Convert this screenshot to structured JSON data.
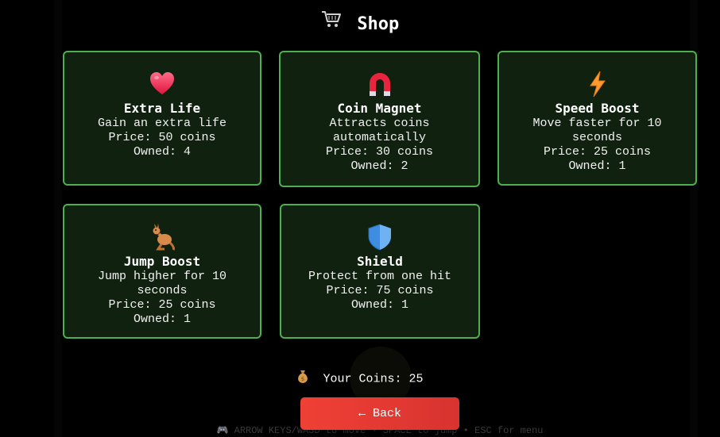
{
  "header": {
    "icon": "shopping-cart-icon",
    "title": "Shop"
  },
  "items": [
    {
      "icon": "heart-icon",
      "name": "Extra Life",
      "description": "Gain an extra life",
      "price": "Price: 50 coins",
      "owned": "Owned: 4"
    },
    {
      "icon": "magnet-icon",
      "name": "Coin Magnet",
      "description": "Attracts coins automatically",
      "price": "Price: 30 coins",
      "owned": "Owned: 2"
    },
    {
      "icon": "lightning-icon",
      "name": "Speed Boost",
      "description": "Move faster for 10 seconds",
      "price": "Price: 25 coins",
      "owned": "Owned: 1"
    },
    {
      "icon": "kangaroo-icon",
      "name": "Jump Boost",
      "description": "Jump higher for 10 seconds",
      "price": "Price: 25 coins",
      "owned": "Owned: 1"
    },
    {
      "icon": "shield-icon",
      "name": "Shield",
      "description": "Protect from one hit",
      "price": "Price: 75 coins",
      "owned": "Owned: 1"
    }
  ],
  "wallet": {
    "icon": "money-bag-icon",
    "label": "Your Coins:",
    "value": "25"
  },
  "back_button": {
    "label": "← Back"
  },
  "hint": {
    "text": "🎮 ARROW KEYS/WASD to move • SPACE to jump • ESC for menu"
  },
  "colors": {
    "background": "#000000",
    "card_background": "#10220f",
    "card_border": "#4caf50",
    "button_accent": "#e53935"
  }
}
